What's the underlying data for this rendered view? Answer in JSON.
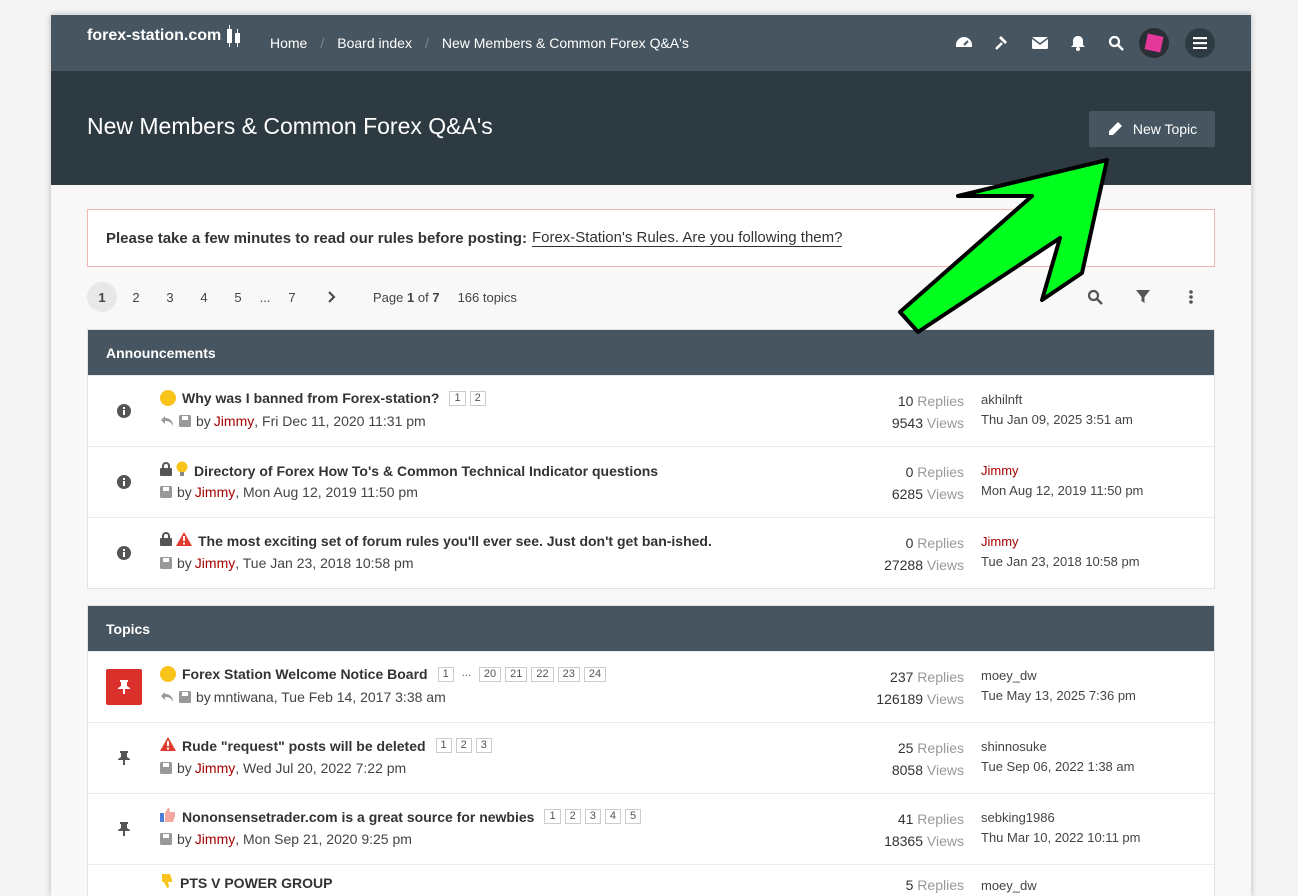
{
  "header": {
    "logo_text": "forex-station.com",
    "breadcrumbs": [
      "Home",
      "Board index",
      "New Members & Common Forex Q&A's"
    ]
  },
  "hero": {
    "title": "New Members & Common Forex Q&A's",
    "new_topic_label": "New Topic"
  },
  "notice": {
    "text": "Please take a few minutes to read our rules before posting:",
    "link_text": "Forex-Station's Rules. Are you following them?"
  },
  "pagination": {
    "pages": [
      "1",
      "2",
      "3",
      "4",
      "5"
    ],
    "ellipsis": "...",
    "last_page": "7",
    "page_label": "Page",
    "current_page": "1",
    "of_label": "of",
    "total_pages": "7",
    "topic_count": "166 topics"
  },
  "announcements": {
    "heading": "Announcements",
    "rows": [
      {
        "title": "Why was I banned from Forex-station?",
        "pages": [
          "1",
          "2"
        ],
        "by": "by",
        "author": "Jimmy",
        "date": ", Fri Dec 11, 2020 11:31 pm",
        "replies": "10",
        "views": "9543",
        "last_user": "akhilnft",
        "last_date": "Thu Jan 09, 2025 3:51 am"
      },
      {
        "title": "Directory of Forex How To's & Common Technical Indicator questions",
        "pages": [],
        "by": "by",
        "author": "Jimmy",
        "date": ", Mon Aug 12, 2019 11:50 pm",
        "replies": "0",
        "views": "6285",
        "last_user": "Jimmy",
        "last_date": "Mon Aug 12, 2019 11:50 pm"
      },
      {
        "title": "The most exciting set of forum rules you'll ever see. Just don't get ban-ished.",
        "pages": [],
        "by": "by",
        "author": "Jimmy",
        "date": ", Tue Jan 23, 2018 10:58 pm",
        "replies": "0",
        "views": "27288",
        "last_user": "Jimmy",
        "last_date": "Tue Jan 23, 2018 10:58 pm"
      }
    ]
  },
  "topics": {
    "heading": "Topics",
    "rows": [
      {
        "title": "Forex Station Welcome Notice Board",
        "pages": [
          "1",
          "...",
          "20",
          "21",
          "22",
          "23",
          "24"
        ],
        "by": "by",
        "author": "mntiwana",
        "date": ", Tue Feb 14, 2017 3:38 am",
        "replies": "237",
        "views": "126189",
        "last_user": "moey_dw",
        "last_date": "Tue May 13, 2025 7:36 pm"
      },
      {
        "title": "Rude \"request\" posts will be deleted",
        "pages": [
          "1",
          "2",
          "3"
        ],
        "by": "by",
        "author": "Jimmy",
        "date": ", Wed Jul 20, 2022 7:22 pm",
        "replies": "25",
        "views": "8058",
        "last_user": "shinnosuke",
        "last_date": "Tue Sep 06, 2022 1:38 am"
      },
      {
        "title": "Nononsensetrader.com is a great source for newbies",
        "pages": [
          "1",
          "2",
          "3",
          "4",
          "5"
        ],
        "by": "by",
        "author": "Jimmy",
        "date": ", Mon Sep 21, 2020 9:25 pm",
        "replies": "41",
        "views": "18365",
        "last_user": "sebking1986",
        "last_date": "Thu Mar 10, 2022 10:11 pm"
      },
      {
        "title": "PTS V POWER GROUP",
        "pages": [],
        "by": "",
        "author": "",
        "date": "",
        "replies": "5",
        "views": "",
        "last_user": "moey_dw",
        "last_date": ""
      }
    ]
  },
  "labels": {
    "replies": "Replies",
    "views": "Views"
  },
  "colors": {
    "nav": "#46555f",
    "hero": "#2d3a42",
    "accent_red": "#a50000",
    "arrow": "#00ff1e"
  }
}
